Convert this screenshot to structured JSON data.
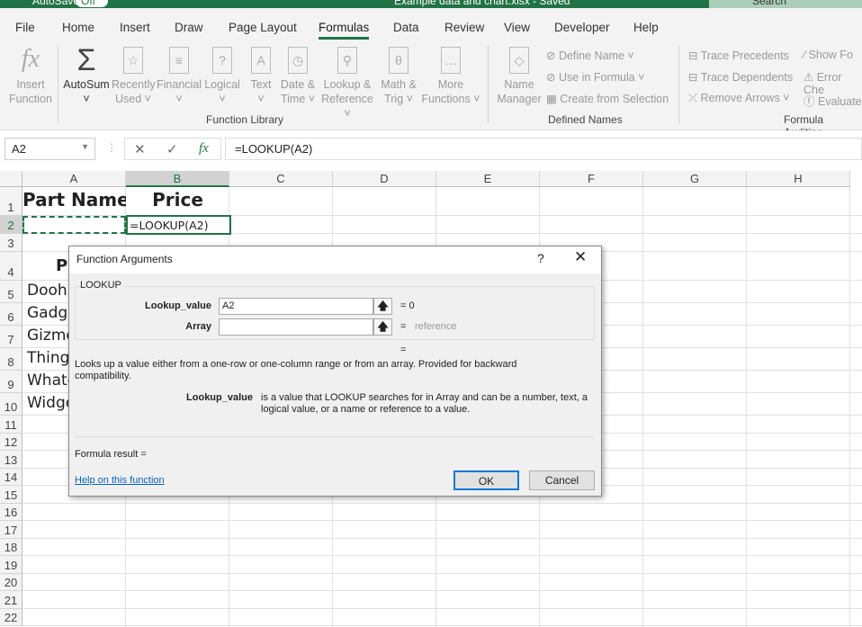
{
  "titlebar": {
    "autosave": "AutoSave",
    "autosave_state": "Off",
    "filename": "Example data and chart.xlsx - Saved",
    "search": "Search"
  },
  "tabs": [
    "File",
    "Home",
    "Insert",
    "Draw",
    "Page Layout",
    "Formulas",
    "Data",
    "Review",
    "View",
    "Developer",
    "Help"
  ],
  "active_tab": "Formulas",
  "ribbon": {
    "function_library": {
      "group": "Function Library",
      "insert1": "Insert",
      "insert2": "Function",
      "autosum": "AutoSum",
      "recent1": "Recently",
      "recent2": "Used ˅",
      "financial": "Financial",
      "logical": "Logical",
      "text": "Text",
      "date1": "Date &",
      "date2": "Time ˅",
      "lookup1": "Lookup &",
      "lookup2": "Reference ˅",
      "math1": "Math &",
      "math2": "Trig ˅",
      "more1": "More",
      "more2": "Functions ˅"
    },
    "defined_names": {
      "group": "Defined Names",
      "name1": "Name",
      "name2": "Manager",
      "define": "Define Name ˅",
      "use": "Use in Formula ˅",
      "create": "Create from Selection"
    },
    "formula_auditing": {
      "group": "Formula Auditing",
      "precedents": "Trace Precedents",
      "dependents": "Trace Dependents",
      "remove": "Remove Arrows ˅",
      "show": "Show Fo",
      "error": "Error Che",
      "evaluate": "Evaluate"
    }
  },
  "formula_bar": {
    "name_box": "A2",
    "formula": "=LOOKUP(A2)"
  },
  "columns": [
    "A",
    "B",
    "C",
    "D",
    "E",
    "F",
    "G",
    "H"
  ],
  "rows": [
    "1",
    "2",
    "3",
    "4",
    "5",
    "6",
    "7",
    "8",
    "9",
    "10",
    "11",
    "12",
    "13",
    "14",
    "15",
    "16",
    "17",
    "18",
    "19",
    "20",
    "21",
    "22"
  ],
  "cells": {
    "A1": "Part Name",
    "B1": "Price",
    "B2": "=LOOKUP(A2)",
    "A4": "P",
    "A5": "Doohi",
    "A6": "Gadge",
    "A7": "Gizmo",
    "A8": "Thinga",
    "A9": "Whatc",
    "A10": "Widge"
  },
  "dialog": {
    "title": "Function Arguments",
    "help": "?",
    "function": "LOOKUP",
    "arg1_label": "Lookup_value",
    "arg1_value": "A2",
    "arg1_result": "= 0",
    "arg2_label": "Array",
    "arg2_value": "",
    "arg2_result": "reference",
    "eq": "=",
    "result_eq": "=",
    "description": "Looks up a value either from a one-row or one-column range or from an array. Provided for backward compatibility.",
    "arg_desc_label": "Lookup_value",
    "arg_desc": "is a value that LOOKUP searches for in Array and can be a number, text, a logical value, or a name or reference to a value.",
    "formula_result": "Formula result =",
    "help_link": "Help on this function",
    "ok": "OK",
    "cancel": "Cancel"
  },
  "colors": {
    "accent": "#217346",
    "link": "#0563c1"
  }
}
